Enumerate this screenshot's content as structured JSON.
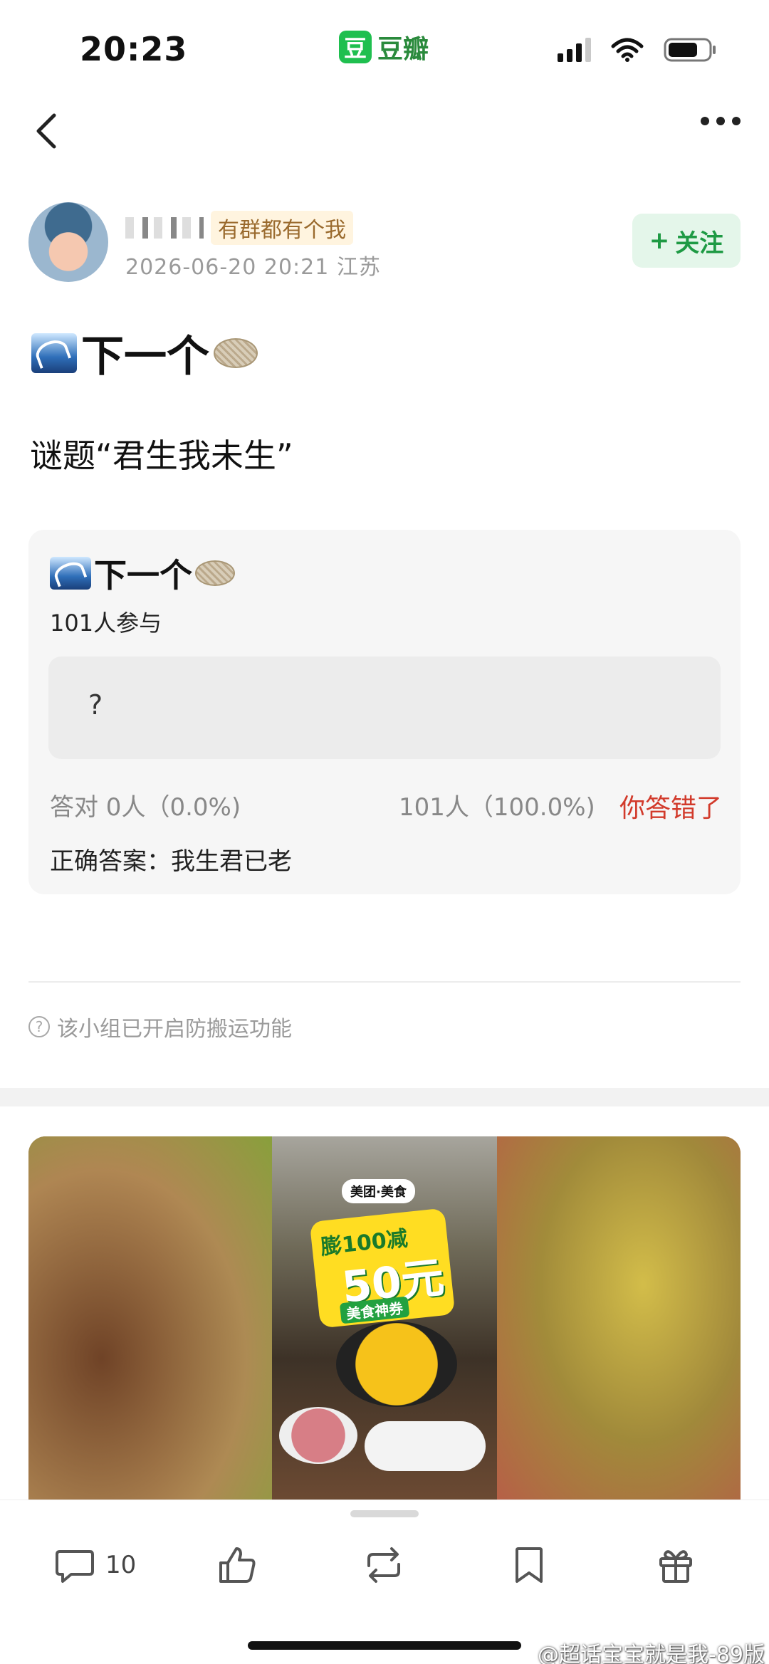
{
  "status_bar": {
    "time": "20:23",
    "app_logo_char": "豆",
    "app_name": "豆瓣",
    "signal_bars_filled": 3,
    "battery_level": 0.7
  },
  "nav": {
    "back_icon": "chevron-left-icon",
    "more_icon": "ellipsis-icon"
  },
  "author": {
    "group_tag": "有群都有个我",
    "post_time": "2026-06-20 20:21",
    "location": "江苏",
    "follow_label": "关注",
    "follow_plus": "+"
  },
  "post": {
    "title": "下一个",
    "text": "谜题“君生我未生”"
  },
  "quiz": {
    "title": "下一个",
    "participants": "101人参与",
    "option_text": "?",
    "correct_stat": "答对  0人（0.0%)",
    "wrong_stat": "101人（100.0%)",
    "result": "你答错了",
    "answer_label": "正确答案：",
    "answer_value": "我生君已老"
  },
  "notice": {
    "icon": "?",
    "text": "该小组已开启防搬运功能"
  },
  "ad": {
    "brand": "美团·美食",
    "line1": "膨100减",
    "line2": "50元",
    "line3": "美食神券"
  },
  "actions": {
    "comment_count": "10",
    "comment_icon": "comment-icon",
    "like_icon": "thumbs-up-icon",
    "repost_icon": "repost-icon",
    "bookmark_icon": "bookmark-icon",
    "gift_icon": "gift-icon"
  },
  "watermark": "@超话宝宝就是我-89版",
  "colors": {
    "brand_green": "#1fbf4f",
    "follow_green": "#1e9a44",
    "wrong_red": "#d23a2b"
  }
}
